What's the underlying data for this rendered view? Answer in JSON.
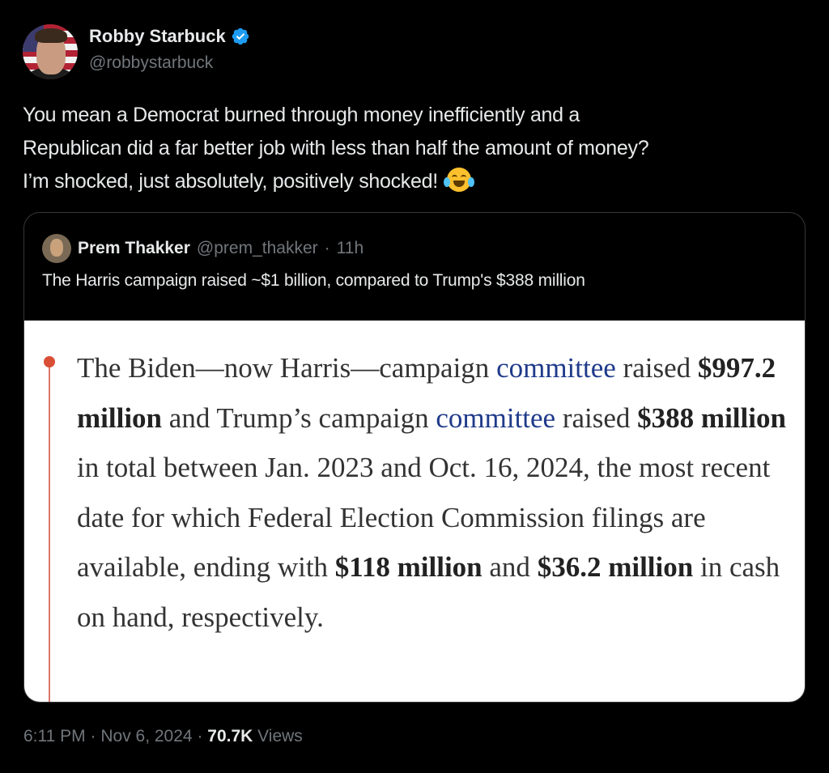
{
  "author": {
    "name": "Robby Starbuck",
    "handle": "@robbystarbuck",
    "verified": true
  },
  "tweet": {
    "text_lines": [
      "You mean a Democrat burned through money inefficiently and a",
      "Republican did a far better job with less than half the amount of money?",
      "I’m shocked, just absolutely, positively shocked!"
    ],
    "emoji": "face-with-tears-of-joy"
  },
  "quoted": {
    "name": "Prem Thakker",
    "handle": "@prem_thakker",
    "separator": "·",
    "age": "11h",
    "text": "The Harris campaign raised ~$1 billion, compared to Trump's $388 million",
    "article": {
      "p1": "The Biden—now Harris—campaign ",
      "link1": "committee",
      "p2": " raised ",
      "b1": "$997.2 million",
      "p3": " and Trump’s campaign ",
      "link2": "committee",
      "p4": " raised ",
      "b2": "$388 million",
      "p5": " in total between Jan. 2023 and Oct. 16, 2024, the most recent date for which Federal Election Commission filings are available, ending with ",
      "b3": "$118 million",
      "p6": " and ",
      "b4": "$36.2 million",
      "p7": " in cash on hand, respectively."
    }
  },
  "meta": {
    "time": "6:11 PM",
    "sep1": "·",
    "date": "Nov 6, 2024",
    "sep2": "·",
    "views_count": "70.7K",
    "views_label": "Views"
  },
  "colors": {
    "background": "#000000",
    "verified": "#1d9bf0",
    "muted": "#71767b",
    "accent_dot": "#d94f36"
  }
}
